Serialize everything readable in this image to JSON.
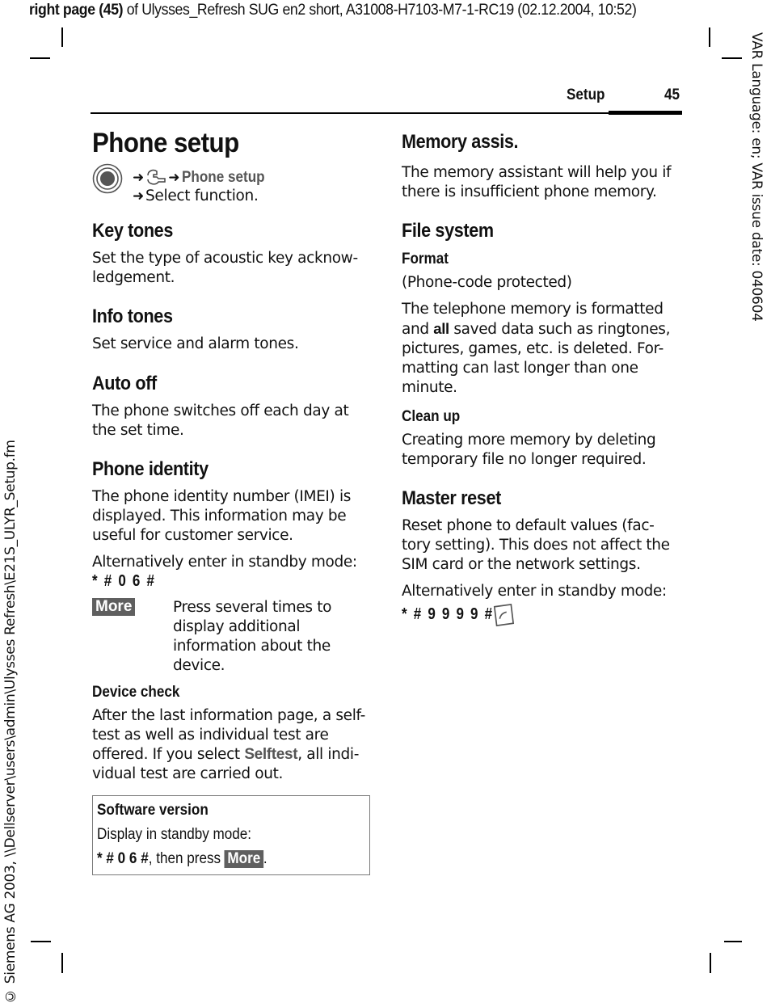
{
  "print_header": {
    "page_ref": "right page (45)",
    "rest": " of Ulysses_Refresh SUG en2 short, A31008-H7103-M7-1-RC19 (02.12.2004, 10:52)"
  },
  "side_right": "VAR Language: en; VAR issue date: 040604",
  "side_left": "© Siemens AG 2003, \\\\Dellserver\\users\\admin\\Ulysses Refresh\\E21S_ULYR_Setup.fm",
  "running_header": {
    "section": "Setup",
    "page_number": "45"
  },
  "icons": {
    "menu_key": "navigation-key-icon",
    "settings": "wrench-icon",
    "arrow": "arrow-right-icon",
    "end_key": "end-call-key-icon"
  },
  "left_column": {
    "title": "Phone setup",
    "nav": {
      "menu_item": "Phone setup",
      "instruction": "Select function."
    },
    "key_tones": {
      "heading": "Key tones",
      "text": "Set the type of acoustic key acknow-ledgement."
    },
    "info_tones": {
      "heading": "Info tones",
      "text": "Set service and alarm tones."
    },
    "auto_off": {
      "heading": "Auto off",
      "text": "The phone switches off each day at the set time."
    },
    "phone_identity": {
      "heading": "Phone identity",
      "text": "The phone identity number (IMEI) is displayed. This information may be useful for customer service.",
      "alt_text": "Alternatively enter in standby mode:",
      "code": "* # 0 6 #",
      "softkey": "More",
      "softkey_text": "Press several times to display additional information about the device."
    },
    "device_check": {
      "heading": "Device check",
      "text_before": "After the last information page, a self-test as well as individual test are offered. If you select ",
      "term": "Selftest",
      "text_after": ", all indi-vidual test are carried out."
    },
    "software_version_box": {
      "title": "Software version",
      "line1": "Display in standby mode:",
      "code": "* # 0 6 #",
      "then_press": ", then press ",
      "softkey": "More",
      "end": "."
    }
  },
  "right_column": {
    "memory_assis": {
      "heading": "Memory assis.",
      "text": "The memory assistant will help you if there is insufficient phone memory."
    },
    "file_system": {
      "heading": "File system",
      "format": {
        "heading": "Format",
        "note": "(Phone-code protected)",
        "text_before": "The telephone memory is formatted and ",
        "bold": "all",
        "text_after": " saved data such as ringtones, pictures, games, etc. is deleted. For-matting can last longer than one minute."
      },
      "clean_up": {
        "heading": "Clean up",
        "text": "Creating more memory by deleting temporary file no longer required."
      }
    },
    "master_reset": {
      "heading": "Master reset",
      "text": "Reset phone to default values (fac-tory setting). This does not affect the SIM card or the network settings.",
      "alt_text": "Alternatively enter in standby mode:",
      "code": "* # 9 9 9 9 #"
    }
  }
}
